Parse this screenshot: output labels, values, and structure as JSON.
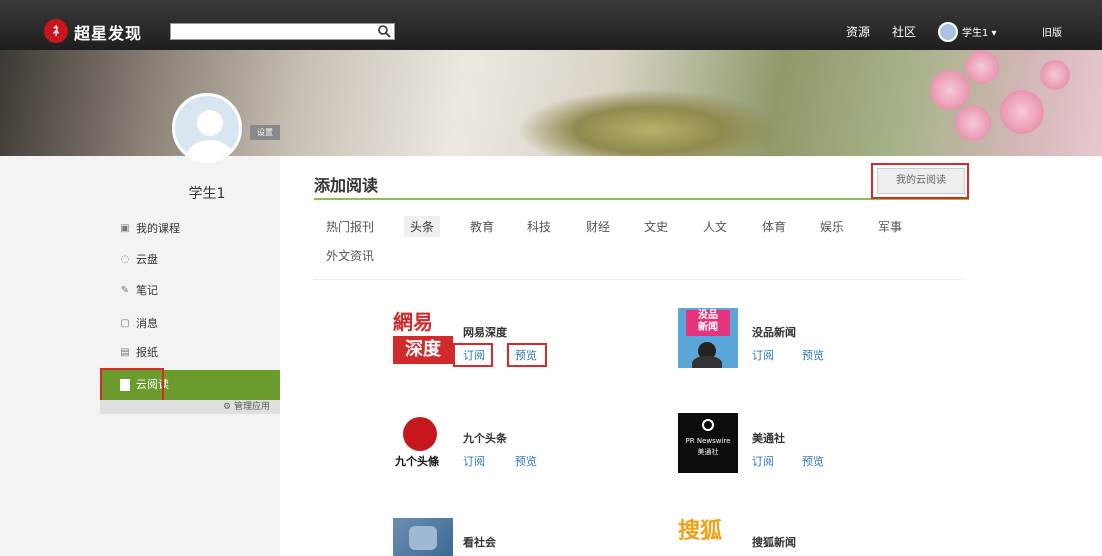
{
  "header": {
    "logo_mark": "ﾈ",
    "logo_text": "超星发现",
    "search_placeholder": "",
    "nav": [
      "资源",
      "社区"
    ],
    "user_label": "学生1 ▾",
    "old_version": "旧版"
  },
  "profile": {
    "settings_label": "设置",
    "username": "学生1"
  },
  "sidebar": {
    "items": [
      {
        "icon": "course-icon",
        "label": "我的课程"
      },
      {
        "icon": "cloud-disk-icon",
        "label": "云盘"
      },
      {
        "icon": "notes-icon",
        "label": "笔记"
      },
      {
        "icon": "message-icon",
        "label": "消息"
      },
      {
        "icon": "newspaper-icon",
        "label": "报纸"
      }
    ],
    "active_item": {
      "icon": "cloud-read-icon",
      "label": "云阅读"
    },
    "manage_apps": "管理应用"
  },
  "main": {
    "title": "添加阅读",
    "my_cloud_button": "我的云阅读",
    "categories": [
      "热门报刊",
      "头条",
      "教育",
      "科技",
      "财经",
      "文史",
      "人文",
      "体育",
      "娱乐",
      "军事",
      "外文资讯"
    ],
    "active_category": "头条",
    "feeds": [
      {
        "name": "网易深度",
        "subscribe": "订阅",
        "preview": "预览",
        "logo_lines": [
          "網易",
          "深度"
        ]
      },
      {
        "name": "没品新闻",
        "subscribe": "订阅",
        "preview": "预览",
        "logo_lines": [
          "没品",
          "新闻"
        ]
      },
      {
        "name": "九个头条",
        "subscribe": "订阅",
        "preview": "预览",
        "logo_lines": [
          "九个头條"
        ]
      },
      {
        "name": "美通社",
        "subscribe": "订阅",
        "preview": "预览",
        "logo_lines": [
          "PR Newswire",
          "美通社"
        ]
      },
      {
        "name": "看社会",
        "subscribe": "",
        "preview": "",
        "logo_lines": []
      },
      {
        "name": "搜狐新闻",
        "subscribe": "",
        "preview": "",
        "logo_lines": [
          "搜狐"
        ]
      }
    ]
  },
  "colors": {
    "accent_green": "#6b9a2d",
    "link_blue": "#2d78b8",
    "highlight_red": "#d42a2a"
  }
}
